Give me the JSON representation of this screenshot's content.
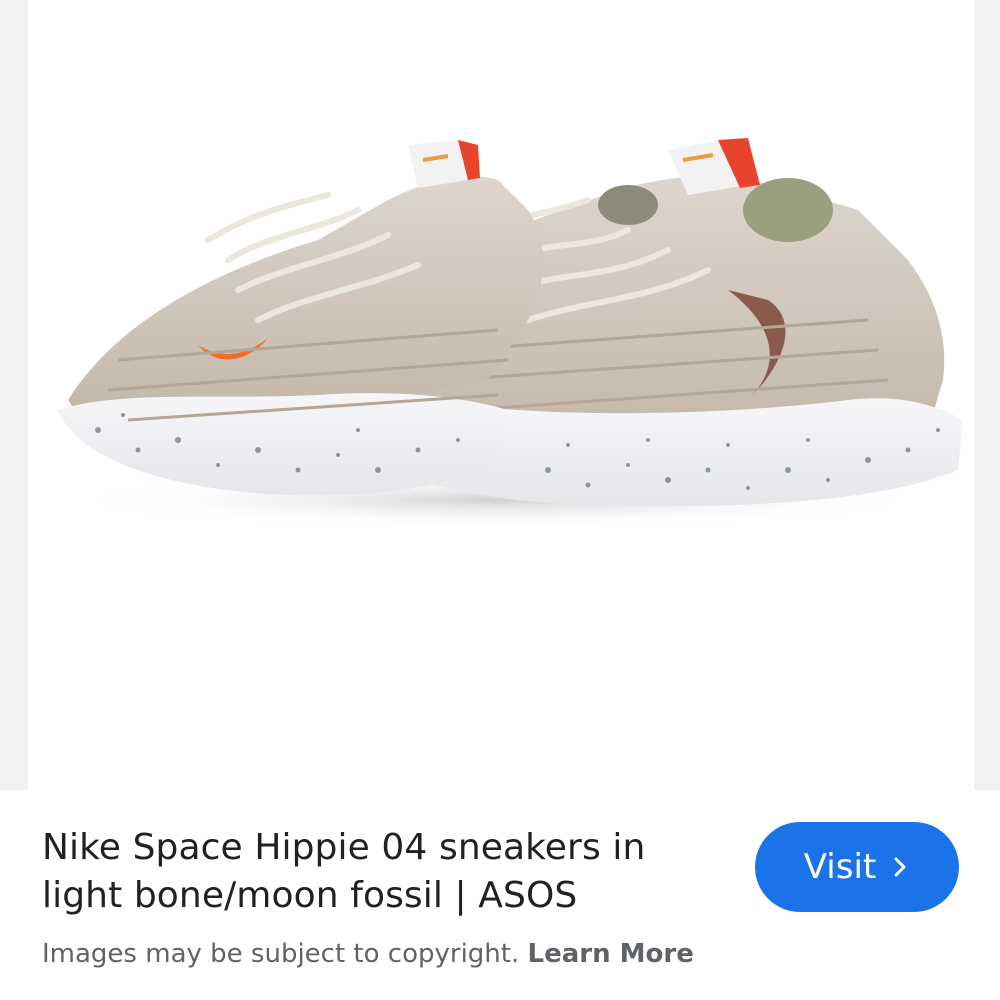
{
  "image": {
    "alt": "Nike Space Hippie 04 sneakers in light bone/moon fossil"
  },
  "result": {
    "title": "Nike Space Hippie 04 sneakers in light bone/moon fossil | ASOS",
    "visit_label": "Visit",
    "visit_icon": "chevron-right-icon"
  },
  "footer": {
    "copyright_text": "Images may be subject to copyright.",
    "learn_more_label": "Learn More"
  },
  "colors": {
    "accent": "#1a73e8",
    "title": "#202124",
    "secondary_text": "#5f6368",
    "panel_background": "#f1f1f3"
  }
}
